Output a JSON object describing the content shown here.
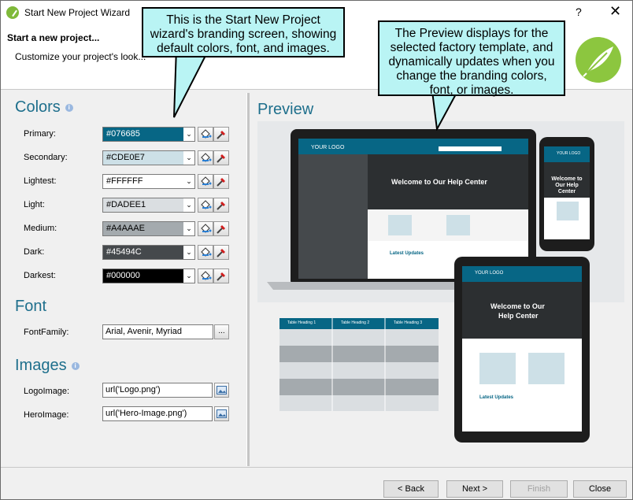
{
  "window": {
    "title": "Start New Project Wizard",
    "help": "?",
    "close": "✕"
  },
  "header": {
    "title": "Start a new project...",
    "subtitle": "Customize your project's look..."
  },
  "callouts": {
    "left": "This is the Start New Project wizard's branding screen, showing default colors, font, and images.",
    "right": "The Preview displays for the selected factory template, and dynamically updates when you change the branding colors, font, or images."
  },
  "colors": {
    "title": "Colors",
    "rows": [
      {
        "label": "Primary:",
        "value": "#076685",
        "bg": "#076685",
        "fg": "#ffffff"
      },
      {
        "label": "Secondary:",
        "value": "#CDE0E7",
        "bg": "#CDE0E7",
        "fg": "#000000"
      },
      {
        "label": "Lightest:",
        "value": "#FFFFFF",
        "bg": "#FFFFFF",
        "fg": "#000000"
      },
      {
        "label": "Light:",
        "value": "#DADEE1",
        "bg": "#DADEE1",
        "fg": "#000000"
      },
      {
        "label": "Medium:",
        "value": "#A4AAAE",
        "bg": "#A4AAAE",
        "fg": "#000000"
      },
      {
        "label": "Dark:",
        "value": "#45494C",
        "bg": "#45494C",
        "fg": "#ffffff"
      },
      {
        "label": "Darkest:",
        "value": "#000000",
        "bg": "#000000",
        "fg": "#ffffff"
      }
    ]
  },
  "font": {
    "title": "Font",
    "label": "FontFamily:",
    "value": "Arial, Avenir, Myriad",
    "browse": "..."
  },
  "images": {
    "title": "Images",
    "logo_label": "LogoImage:",
    "logo_value": "url('Logo.png')",
    "hero_label": "HeroImage:",
    "hero_value": "url('Hero-Image.png')"
  },
  "preview": {
    "title": "Preview",
    "logo_text": "YOUR LOGO",
    "hero_text": "Welcome to Our Help Center",
    "hero_line1": "Welcome to Our",
    "hero_line2": "Help Center",
    "latest": "Latest Updates",
    "table_headers": [
      "Table Heading 1",
      "Table Heading 2",
      "Table Heading 3"
    ]
  },
  "footer": {
    "back": "< Back",
    "next": "Next >",
    "finish": "Finish",
    "close": "Close"
  }
}
